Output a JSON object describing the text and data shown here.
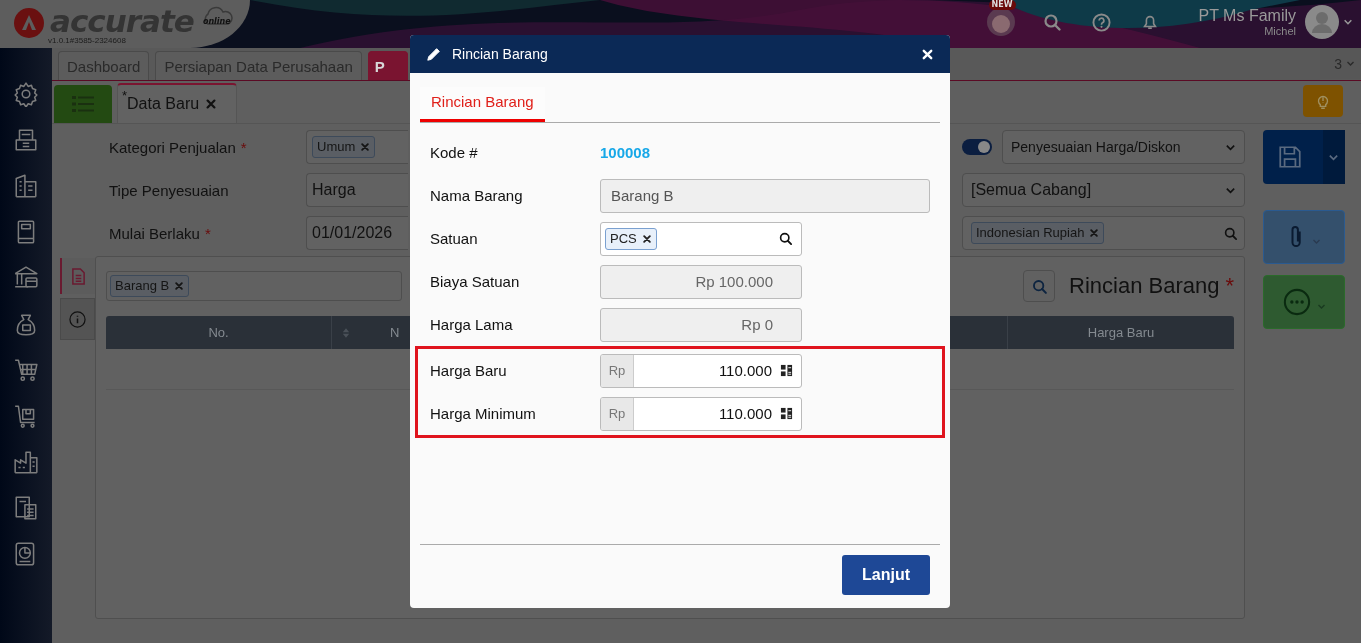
{
  "header": {
    "logo": "accurate",
    "logo_sub": "online",
    "version": "v1.0.1#3585-2324608",
    "badge": "NEW",
    "company": "PT Ms Family",
    "user": "Michel"
  },
  "main_tabs": [
    {
      "label": "Dashboard",
      "selected": false
    },
    {
      "label": "Persiapan Data Perusahaan",
      "selected": false
    },
    {
      "label": "P",
      "selected": true
    }
  ],
  "tab_count": "3",
  "sub_tabs": [
    {
      "label": "Data Baru",
      "modified_mark": "*",
      "selected": true
    }
  ],
  "form": {
    "fields": [
      {
        "kind": "tags",
        "label": "Kategori Penjualan",
        "required_mark": "*",
        "tags": [
          "Umum"
        ]
      },
      {
        "kind": "select",
        "label": "Tipe Penyesuaian",
        "value": "Harga"
      },
      {
        "kind": "date",
        "label": "Mulai Berlaku",
        "required_mark": "*",
        "value": "01/01/2026"
      }
    ],
    "toggle_on": true,
    "type_select": "Penyesuaian Harga/Diskon",
    "branch_select": "[Semua Cabang]",
    "currency_tags": [
      "Indonesian Rupiah"
    ]
  },
  "detail": {
    "item_tags": [
      "Barang B"
    ],
    "title": "Rincian Barang",
    "required_mark": "*",
    "columns": [
      "No.",
      "N",
      "Harga Baru"
    ]
  },
  "modal": {
    "title": "Rincian Barang",
    "tabs": [
      {
        "label": "Rincian Barang",
        "selected": true
      }
    ],
    "fields": [
      {
        "kind": "link",
        "label": "Kode #",
        "value": "100008",
        "highlighted": false
      },
      {
        "kind": "text",
        "label": "Nama Barang",
        "value": "Barang B",
        "highlighted": false
      },
      {
        "kind": "tags",
        "label": "Satuan",
        "tags": [
          "PCS"
        ],
        "highlighted": false
      },
      {
        "kind": "readonly",
        "label": "Biaya Satuan",
        "value": "Rp 100.000",
        "highlighted": false
      },
      {
        "kind": "readonly",
        "label": "Harga Lama",
        "value": "Rp 0",
        "highlighted": false
      },
      {
        "kind": "currency",
        "label": "Harga Baru",
        "prefix": "Rp",
        "value": "110.000",
        "highlighted": true
      },
      {
        "kind": "currency",
        "label": "Harga Minimum",
        "prefix": "Rp",
        "value": "110.000",
        "highlighted": true
      }
    ],
    "button": "Lanjut"
  }
}
